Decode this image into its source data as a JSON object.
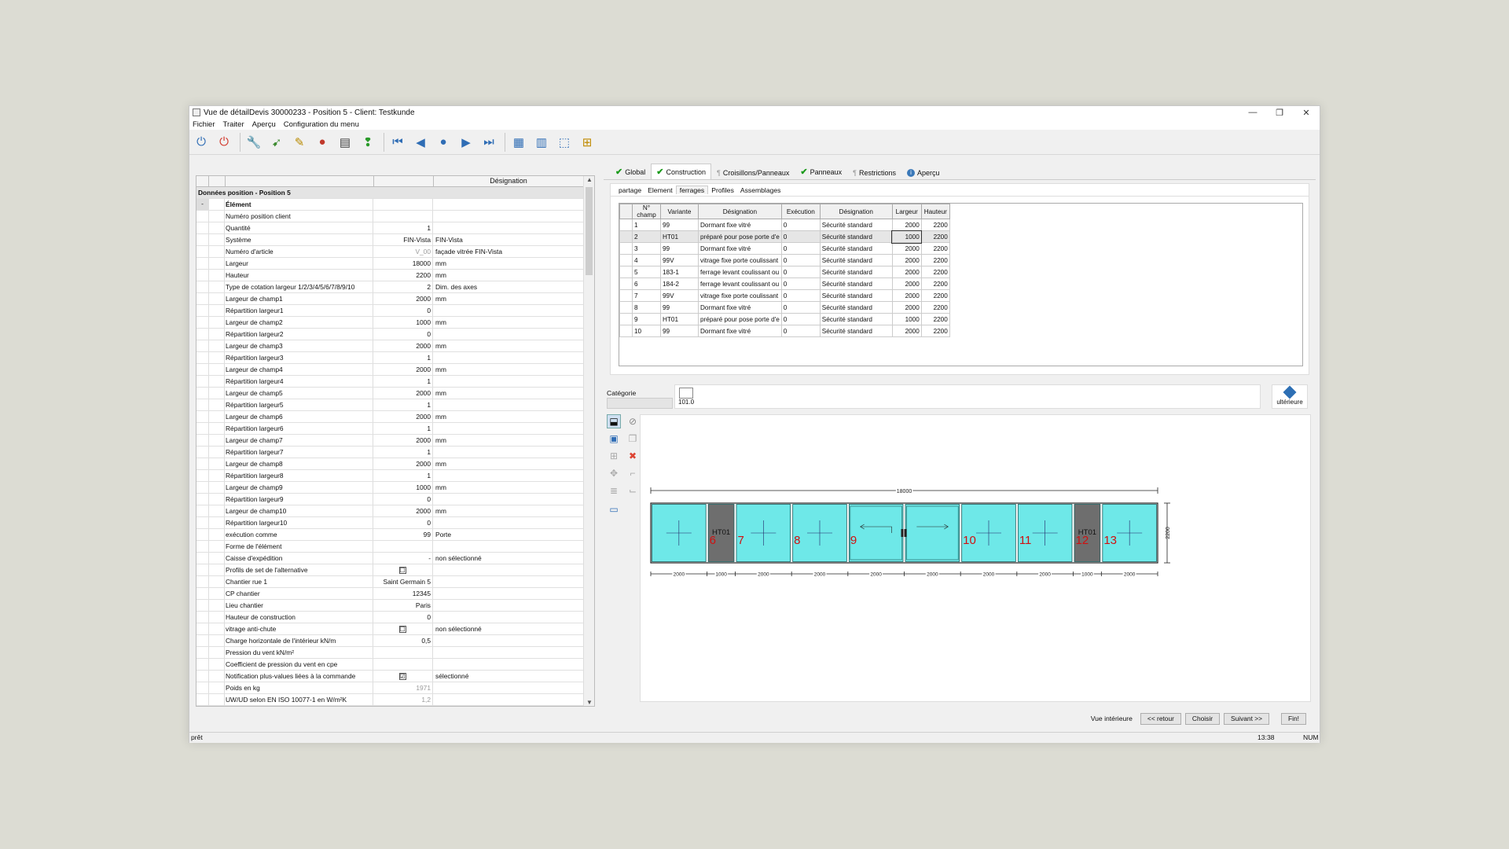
{
  "window": {
    "title": "Vue de détailDevis 30000233 - Position 5 - Client: Testkunde",
    "controls": [
      "—",
      "❐",
      "✕"
    ]
  },
  "menu": [
    "Fichier",
    "Traiter",
    "Aperçu",
    "Configuration du menu"
  ],
  "toolbar": [
    {
      "name": "power-blue-icon",
      "glyph": "⏻",
      "color": "#2f6db5"
    },
    {
      "name": "power-red-icon",
      "glyph": "⏻",
      "color": "#d2382b"
    },
    {
      "name": "tools-icon",
      "glyph": "🔧",
      "color": "#555"
    },
    {
      "name": "wizard-icon",
      "glyph": "➹",
      "color": "#3c8a2f"
    },
    {
      "name": "edit-icon",
      "glyph": "✎",
      "color": "#b88a00"
    },
    {
      "name": "colors-icon",
      "glyph": "●",
      "color": "#c0392b"
    },
    {
      "name": "document-icon",
      "glyph": "▤",
      "color": "#444"
    },
    {
      "name": "traffic-light-icon",
      "glyph": "❢",
      "color": "#2a9a2a"
    },
    {
      "name": "first-icon",
      "glyph": "⏮",
      "color": "#2f6db5"
    },
    {
      "name": "prev-icon",
      "glyph": "◀",
      "color": "#2f6db5"
    },
    {
      "name": "record-icon",
      "glyph": "●",
      "color": "#2f6db5"
    },
    {
      "name": "next-icon",
      "glyph": "▶",
      "color": "#2f6db5"
    },
    {
      "name": "last-icon",
      "glyph": "⏭",
      "color": "#2f6db5"
    },
    {
      "name": "grid-view-icon",
      "glyph": "▦",
      "color": "#2f6db5"
    },
    {
      "name": "table-view-icon",
      "glyph": "▥",
      "color": "#2f6db5"
    },
    {
      "name": "select-view-icon",
      "glyph": "⬚",
      "color": "#2f6db5"
    },
    {
      "name": "tree-icon",
      "glyph": "⊞",
      "color": "#c08a00"
    }
  ],
  "left_grid": {
    "header_designation": "Désignation",
    "section": "Données position - Position 5",
    "group": "Élément",
    "rows": [
      {
        "label": "Numéro position client",
        "value": "",
        "desc": ""
      },
      {
        "label": "Quantité",
        "value": "1",
        "desc": ""
      },
      {
        "label": "Système",
        "value": "FIN-Vista",
        "desc": "FIN-Vista"
      },
      {
        "label": "Numéro d'article",
        "value": "V_00",
        "desc": "façade vitrée FIN-Vista"
      },
      {
        "label": "Largeur",
        "value": "18000",
        "desc": "mm"
      },
      {
        "label": "Hauteur",
        "value": "2200",
        "desc": "mm"
      },
      {
        "label": "Type de cotation largeur 1/2/3/4/5/6/7/8/9/10",
        "value": "2",
        "desc": "Dim. des axes"
      },
      {
        "label": "Largeur de champ1",
        "value": "2000",
        "desc": "mm"
      },
      {
        "label": "Répartition largeur1",
        "value": "0",
        "desc": ""
      },
      {
        "label": "Largeur de champ2",
        "value": "1000",
        "desc": "mm"
      },
      {
        "label": "Répartition largeur2",
        "value": "0",
        "desc": ""
      },
      {
        "label": "Largeur de champ3",
        "value": "2000",
        "desc": "mm"
      },
      {
        "label": "Répartition largeur3",
        "value": "1",
        "desc": ""
      },
      {
        "label": "Largeur de champ4",
        "value": "2000",
        "desc": "mm"
      },
      {
        "label": "Répartition largeur4",
        "value": "1",
        "desc": ""
      },
      {
        "label": "Largeur de champ5",
        "value": "2000",
        "desc": "mm"
      },
      {
        "label": "Répartition largeur5",
        "value": "1",
        "desc": ""
      },
      {
        "label": "Largeur de champ6",
        "value": "2000",
        "desc": "mm"
      },
      {
        "label": "Répartition largeur6",
        "value": "1",
        "desc": ""
      },
      {
        "label": "Largeur de champ7",
        "value": "2000",
        "desc": "mm"
      },
      {
        "label": "Répartition largeur7",
        "value": "1",
        "desc": ""
      },
      {
        "label": "Largeur de champ8",
        "value": "2000",
        "desc": "mm"
      },
      {
        "label": "Répartition largeur8",
        "value": "1",
        "desc": ""
      },
      {
        "label": "Largeur de champ9",
        "value": "1000",
        "desc": "mm"
      },
      {
        "label": "Répartition largeur9",
        "value": "0",
        "desc": ""
      },
      {
        "label": "Largeur de champ10",
        "value": "2000",
        "desc": "mm"
      },
      {
        "label": "Répartition largeur10",
        "value": "0",
        "desc": ""
      },
      {
        "label": "exécution comme",
        "value": "99",
        "desc": "Porte"
      },
      {
        "label": "Forme de l'élément",
        "value": "",
        "desc": ""
      },
      {
        "label": "Caisse d'expédition",
        "value": "-",
        "desc": "non sélectionné"
      },
      {
        "label": "Profils de set de l'alternative",
        "value": "☐",
        "desc": ""
      },
      {
        "label": "Chantier rue 1",
        "value": "Saint Germain 5",
        "desc": ""
      },
      {
        "label": "CP chantier",
        "value": "12345",
        "desc": ""
      },
      {
        "label": "Lieu chantier",
        "value": "Paris",
        "desc": ""
      },
      {
        "label": "Hauteur de construction",
        "value": "0",
        "desc": ""
      },
      {
        "label": "vitrage anti-chute",
        "value": "☐",
        "desc": "non sélectionné"
      },
      {
        "label": "Charge horizontale de l'intérieur kN/m",
        "value": "0,5",
        "desc": ""
      },
      {
        "label": "Pression du vent kN/m²",
        "value": "",
        "desc": ""
      },
      {
        "label": "Coefficient de pression du vent en cpe",
        "value": "",
        "desc": ""
      },
      {
        "label": "Notification plus-values liées à la commande",
        "value": "☑",
        "desc": "sélectionné"
      },
      {
        "label": "Poids en kg",
        "value": "1971",
        "desc": ""
      },
      {
        "label": "UW/UD selon EN ISO 10077-1 en W/m²K",
        "value": "1,2",
        "desc": ""
      }
    ]
  },
  "tabs": [
    {
      "label": "Global",
      "mark": "check"
    },
    {
      "label": "Construction",
      "mark": "check"
    },
    {
      "label": "Croisillons/Panneaux",
      "mark": "gray"
    },
    {
      "label": "Panneaux",
      "mark": "check"
    },
    {
      "label": "Restrictions",
      "mark": "gray"
    },
    {
      "label": "Aperçu",
      "mark": "info"
    }
  ],
  "subtabs": [
    "partage",
    "Element",
    "ferrages",
    "Profiles",
    "Assemblages"
  ],
  "ferrages": {
    "headers": [
      "N° champ",
      "Variante",
      "Désignation",
      "Exécution",
      "Désignation",
      "Largeur",
      "Hauteur"
    ],
    "rows": [
      [
        "1",
        "99",
        "Dormant fixe vitré",
        "0",
        "Sécurité standard",
        "2000",
        "2200"
      ],
      [
        "2",
        "HT01",
        "préparé pour pose porte d'e",
        "0",
        "Sécurité standard",
        "1000",
        "2200"
      ],
      [
        "3",
        "99",
        "Dormant fixe vitré",
        "0",
        "Sécurité standard",
        "2000",
        "2200"
      ],
      [
        "4",
        "99V",
        "vitrage fixe porte coulissant",
        "0",
        "Sécurité standard",
        "2000",
        "2200"
      ],
      [
        "5",
        "183-1",
        "ferrage levant coulissant ou",
        "0",
        "Sécurité standard",
        "2000",
        "2200"
      ],
      [
        "6",
        "184-2",
        "ferrage levant coulissant ou",
        "0",
        "Sécurité standard",
        "2000",
        "2200"
      ],
      [
        "7",
        "99V",
        "vitrage fixe porte coulissant",
        "0",
        "Sécurité standard",
        "2000",
        "2200"
      ],
      [
        "8",
        "99",
        "Dormant fixe vitré",
        "0",
        "Sécurité standard",
        "2000",
        "2200"
      ],
      [
        "9",
        "HT01",
        "préparé pour pose porte d'e",
        "0",
        "Sécurité standard",
        "1000",
        "2200"
      ],
      [
        "10",
        "99",
        "Dormant fixe vitré",
        "0",
        "Sécurité standard",
        "2000",
        "2200"
      ]
    ]
  },
  "category": {
    "label": "Catégorie",
    "item": "101.0",
    "ulterior": "ultérieure"
  },
  "drawing": {
    "total_width": "18000",
    "height": "2200",
    "panels": [
      {
        "w": 2000,
        "type": "glass",
        "num": "",
        "label": ""
      },
      {
        "w": 1000,
        "type": "door",
        "num": "6",
        "label": "HT01"
      },
      {
        "w": 2000,
        "type": "glass",
        "num": "7",
        "label": ""
      },
      {
        "w": 2000,
        "type": "glass",
        "num": "8",
        "label": ""
      },
      {
        "w": 2000,
        "type": "slide-left",
        "num": "9",
        "label": ""
      },
      {
        "w": 2000,
        "type": "slide-right",
        "num": "",
        "label": ""
      },
      {
        "w": 2000,
        "type": "glass",
        "num": "10",
        "label": ""
      },
      {
        "w": 2000,
        "type": "glass",
        "num": "11",
        "label": ""
      },
      {
        "w": 1000,
        "type": "door",
        "num": "12",
        "label": "HT01"
      },
      {
        "w": 2000,
        "type": "glass",
        "num": "13",
        "label": ""
      }
    ],
    "dims": [
      "2000",
      "1000",
      "2000",
      "2000",
      "2000",
      "2000",
      "2000",
      "2000",
      "1000",
      "2000"
    ]
  },
  "bottom": {
    "view_label": "Vue intérieure",
    "buttons": [
      "<< retour",
      "Choisir",
      "Suivant >>",
      "Fin!"
    ]
  },
  "status": {
    "left": "prêt",
    "time": "13:38",
    "num": "NUM"
  },
  "colors": {
    "glass": "#6ee8e8",
    "door": "#6e6e6e",
    "numbers": "#d01010"
  }
}
